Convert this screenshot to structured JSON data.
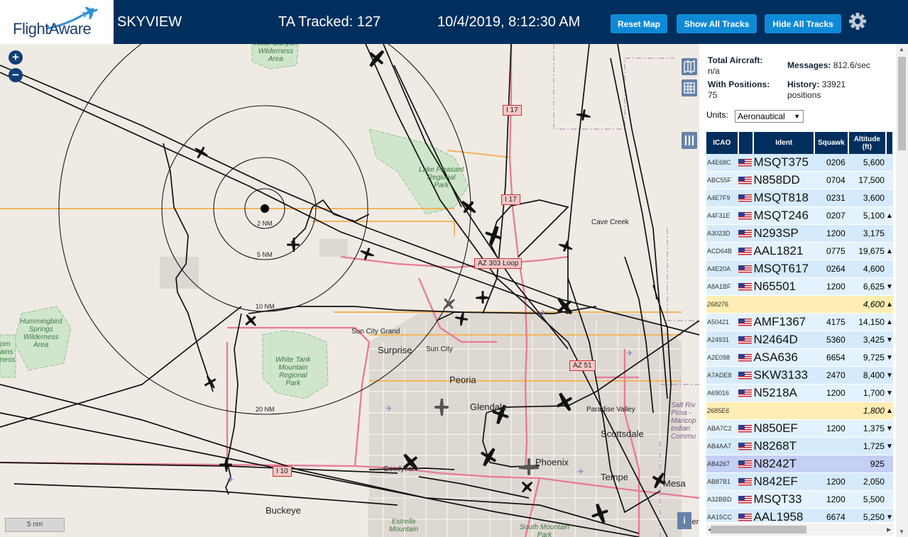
{
  "header": {
    "logo_text": "FlightAware",
    "app_name": "SKYVIEW",
    "tracked": "TA Tracked: 127",
    "datetime": "10/4/2019, 8:12:30 AM",
    "reset_label": "Reset Map",
    "show_tracks_label": "Show All Tracks",
    "hide_tracks_label": "Hide All Tracks",
    "colors": {
      "bar": "#002f5d",
      "button": "#0f8ad6"
    }
  },
  "map": {
    "zoom_in": "+",
    "zoom_out": "−",
    "scale": "5 nm",
    "info": "i",
    "rings": [
      "2 NM",
      "5 NM",
      "10 NM",
      "20 NM"
    ],
    "places": {
      "river_canyon": "River Canyon\nWilderness\nArea",
      "lake_pleasant": "Lake Pleasant\nRegional\nPark",
      "cave_creek": "Cave Creek",
      "hummingbird": "Hummingbird\nSprings\nWilderness\nArea",
      "horn": "orn\nains\nness",
      "sun_city_grand": "Sun City Grand",
      "surprise": "Surprise",
      "sun_city": "Sun City",
      "white_tank": "White Tank\nMountain\nRegional\nPark",
      "peoria": "Peoria",
      "glendale": "Glendale",
      "paradise_valley": "Paradise Valley",
      "scottsdale": "Scottsdale",
      "salt_river": "Salt Riv\nPima -\nMaricop\nIndian\nCommu",
      "phoenix": "Phoenix",
      "tempe": "Tempe",
      "mesa": "Mesa",
      "goodyear": "Goodyear",
      "buckeye": "Buckeye",
      "estrella": "Estrella\nMountain",
      "south_mountain": "South Mountain\nPark",
      "gilbert": "Gilber"
    },
    "roads": {
      "i17_a": "I 17",
      "i17_b": "I 17",
      "az303": "AZ 303 Loop",
      "az51": "AZ 51",
      "i10": "I 10"
    }
  },
  "panel": {
    "total_label": "Total Aircraft:",
    "total_value": "n/a",
    "messages_label": "Messages:",
    "messages_value": "812.6/sec",
    "withpos_label": "With Positions:",
    "withpos_value": "75",
    "history_label": "History:",
    "history_value": "33921",
    "history_unit": "positions",
    "units_label": "Units:",
    "units_value": "Aeronautical",
    "columns": {
      "icao": "ICAO",
      "ident": "Ident",
      "squawk": "Squawk",
      "altitude": "Altitude",
      "altitude_unit": "(ft)"
    },
    "rows": [
      {
        "icao": "A4E68C",
        "ident": "MSQT375",
        "squawk": "0206",
        "alt": "5,600",
        "trend": "",
        "flag": true
      },
      {
        "icao": "ABC55F",
        "ident": "N858DD",
        "squawk": "0704",
        "alt": "17,500",
        "trend": "",
        "flag": true
      },
      {
        "icao": "A4E7F9",
        "ident": "MSQT818",
        "squawk": "0231",
        "alt": "3,600",
        "trend": "",
        "flag": true
      },
      {
        "icao": "A4F31E",
        "ident": "MSQT246",
        "squawk": "0207",
        "alt": "5,100",
        "trend": "▲",
        "flag": true
      },
      {
        "icao": "A3023D",
        "ident": "N293SP",
        "squawk": "1200",
        "alt": "3,175",
        "trend": "",
        "flag": true
      },
      {
        "icao": "ACD64B",
        "ident": "AAL1821",
        "squawk": "0775",
        "alt": "19,675",
        "trend": "▲",
        "flag": true
      },
      {
        "icao": "A4E20A",
        "ident": "MSQT617",
        "squawk": "0264",
        "alt": "4,600",
        "trend": "",
        "flag": true
      },
      {
        "icao": "A8A1BF",
        "ident": "N65501",
        "squawk": "1200",
        "alt": "6,625",
        "trend": "▼",
        "flag": true
      },
      {
        "icao": "268276",
        "ident": "",
        "squawk": "",
        "alt": "4,600",
        "trend": "▲",
        "flag": false
      },
      {
        "icao": "A50421",
        "ident": "AMF1367",
        "squawk": "4175",
        "alt": "14,150",
        "trend": "▲",
        "flag": true
      },
      {
        "icao": "A24931",
        "ident": "N2464D",
        "squawk": "5360",
        "alt": "3,425",
        "trend": "▼",
        "flag": true
      },
      {
        "icao": "A2E098",
        "ident": "ASA636",
        "squawk": "6654",
        "alt": "9,725",
        "trend": "▼",
        "flag": true
      },
      {
        "icao": "A7ADE8",
        "ident": "SKW3133",
        "squawk": "2470",
        "alt": "8,400",
        "trend": "▼",
        "flag": true
      },
      {
        "icao": "A69016",
        "ident": "N5218A",
        "squawk": "1200",
        "alt": "1,700",
        "trend": "▼",
        "flag": true
      },
      {
        "icao": "2685E6",
        "ident": "",
        "squawk": "",
        "alt": "1,800",
        "trend": "▲",
        "flag": false
      },
      {
        "icao": "ABA7C2",
        "ident": "N850EF",
        "squawk": "1200",
        "alt": "1,375",
        "trend": "▼",
        "flag": true
      },
      {
        "icao": "AB4AA7",
        "ident": "N8268T",
        "squawk": "",
        "alt": "1,725",
        "trend": "▼",
        "flag": true
      },
      {
        "icao": "AB4267",
        "ident": "N8242T",
        "squawk": "",
        "alt": "925",
        "trend": "",
        "flag": true
      },
      {
        "icao": "AB87B1",
        "ident": "N842EF",
        "squawk": "1200",
        "alt": "2,050",
        "trend": "",
        "flag": true
      },
      {
        "icao": "A32BBD",
        "ident": "MSQT33",
        "squawk": "1200",
        "alt": "5,500",
        "trend": "",
        "flag": true
      },
      {
        "icao": "AA15CC",
        "ident": "AAL1958",
        "squawk": "6674",
        "alt": "5,250",
        "trend": "▼",
        "flag": true
      }
    ]
  }
}
